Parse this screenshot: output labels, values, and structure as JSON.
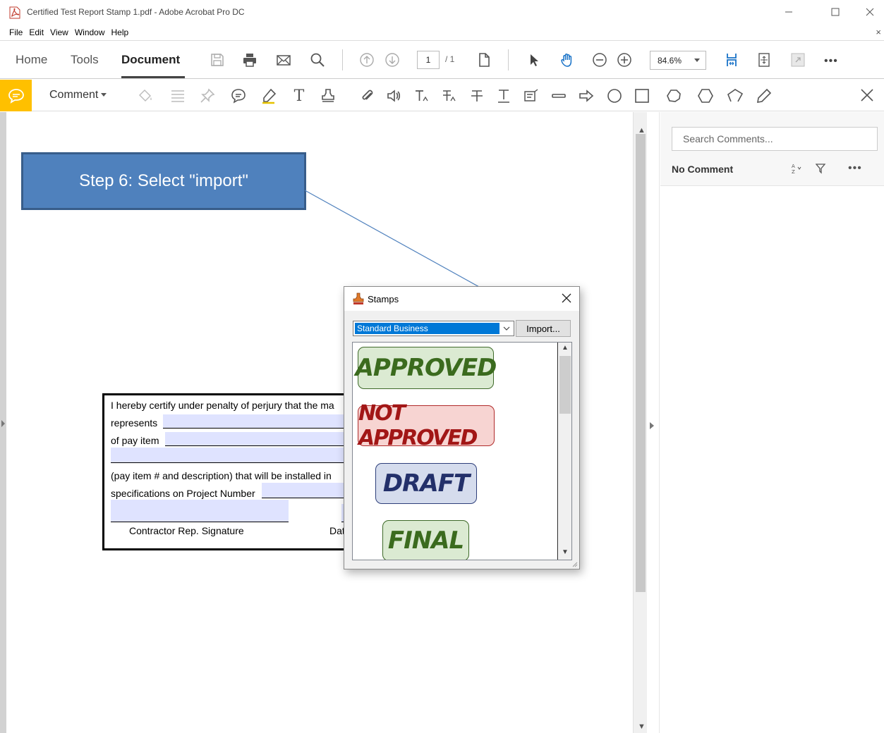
{
  "window": {
    "title": "Certified Test Report Stamp 1.pdf - Adobe Acrobat Pro DC"
  },
  "menu": [
    "File",
    "Edit",
    "View",
    "Window",
    "Help"
  ],
  "menu_close": "×",
  "toolbar": {
    "tabs": {
      "home": "Home",
      "tools": "Tools",
      "document": "Document"
    },
    "page_current": "1",
    "page_total": "/ 1",
    "zoom": "84.6%",
    "more": "•••"
  },
  "comment_toolbar": {
    "label": "Comment"
  },
  "callout": {
    "text": "Step 6: Select \"import\""
  },
  "form": {
    "line1": "I hereby certify under penalty of perjury that the ma",
    "line2": "represents",
    "line3": "of pay item",
    "line4": "(pay item # and description)  that will be installed in",
    "line5": "specifications on Project Number",
    "sig_label": "Contractor Rep. Signature",
    "date_label": "Dat"
  },
  "stamps_dialog": {
    "title": "Stamps",
    "selected_category": "Standard Business",
    "import_label": "Import...",
    "stamps": [
      "APPROVED",
      "NOT APPROVED",
      "DRAFT",
      "FINAL"
    ]
  },
  "comments_panel": {
    "search_placeholder": "Search Comments...",
    "status": "No Comment",
    "more": "•••"
  },
  "colors": {
    "comment_accent": "#ffc000",
    "callout_fill": "#4f81bd",
    "callout_border": "#385d8a",
    "form_field": "#dfe3ff",
    "select_highlight": "#0078d7"
  }
}
